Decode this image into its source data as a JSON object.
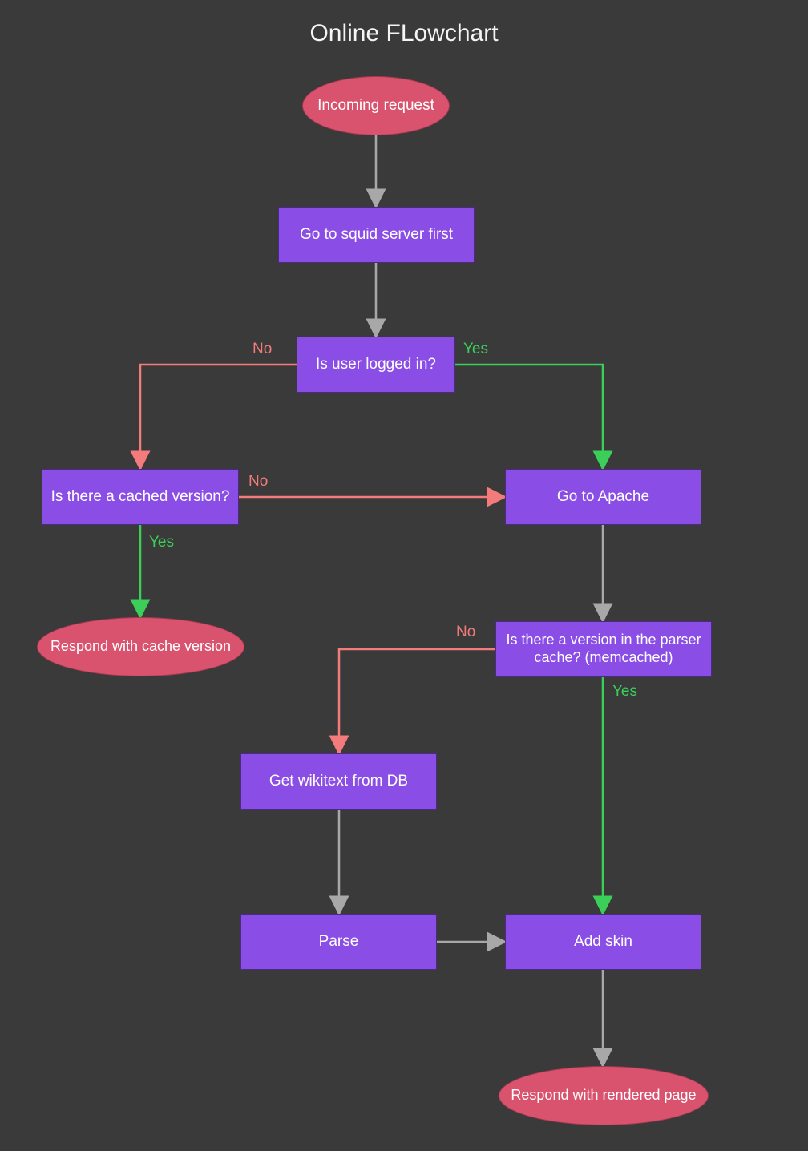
{
  "title": "Online FLowchart",
  "nodes": {
    "incoming": {
      "label": "Incoming request"
    },
    "squid": {
      "label": "Go to squid server first"
    },
    "logged": {
      "label": "Is user logged in?"
    },
    "cached": {
      "label": "Is there a cached version?"
    },
    "apache": {
      "label": "Go to Apache"
    },
    "respond_cache": {
      "label": "Respond with cache version"
    },
    "memcached": {
      "label": "Is there a version in the parser cache? (memcached)"
    },
    "wikitext": {
      "label": "Get wikitext from DB"
    },
    "parse": {
      "label": "Parse"
    },
    "addskin": {
      "label": "Add skin"
    },
    "respond_rendered": {
      "label": "Respond with rendered page"
    }
  },
  "edge_labels": {
    "logged_no": "No",
    "logged_yes": "Yes",
    "cached_no": "No",
    "cached_yes": "Yes",
    "mem_no": "No",
    "mem_yes": "Yes"
  },
  "colors": {
    "gray": "#a8a8a8",
    "green": "#3bcf5a",
    "red": "#f47b7b"
  }
}
